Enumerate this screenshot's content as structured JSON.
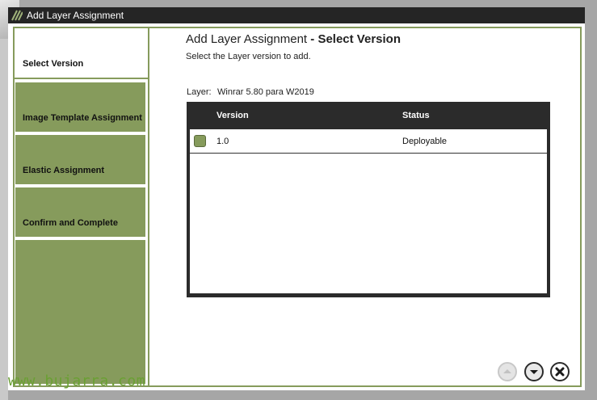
{
  "window": {
    "title": "Add Layer Assignment"
  },
  "header": {
    "title": "Add Layer Assignment",
    "separator": " - ",
    "step_title": "Select Version",
    "subtitle": "Select the Layer version to add."
  },
  "sidebar": {
    "steps": [
      {
        "label": "Select Version",
        "active": true
      },
      {
        "label": "Image Template Assignment",
        "active": false
      },
      {
        "label": "Elastic Assignment",
        "active": false
      },
      {
        "label": "Confirm and Complete",
        "active": false
      }
    ]
  },
  "layer": {
    "label": "Layer:",
    "value": "Winrar 5.80 para W2019"
  },
  "table": {
    "columns": [
      "Version",
      "Status"
    ],
    "rows": [
      {
        "version": "1.0",
        "status": "Deployable",
        "selected": true
      }
    ]
  },
  "navigation": {
    "buttons": [
      "up-arrow-icon",
      "down-arrow-icon",
      "close-icon"
    ]
  },
  "watermark": "www.bujarra.com",
  "colors": {
    "accent": "#869b5c",
    "titlebar": "#252525",
    "table_header": "#2b2b2b",
    "watermark": "#6aa033"
  }
}
